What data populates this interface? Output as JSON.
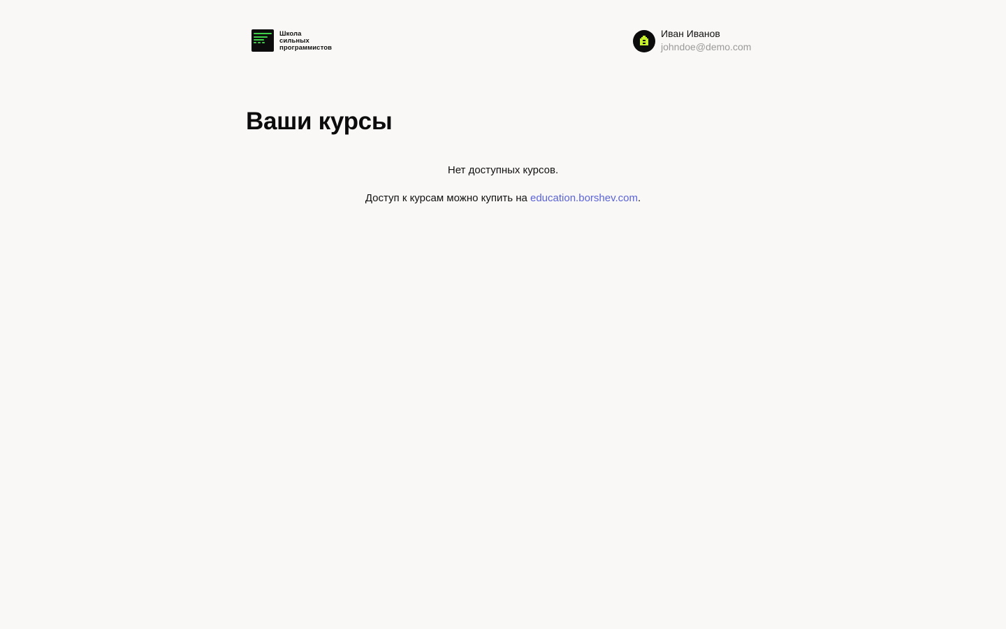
{
  "brand": {
    "name_lines": [
      "Школа",
      "сильных",
      "программистов"
    ],
    "accent_color": "#3fd14a"
  },
  "user": {
    "name": "Иван Иванов",
    "email": "johndoe@demo.com",
    "avatar_icon": "pixel-house-icon",
    "avatar_color": "#c6f02e"
  },
  "main": {
    "title": "Ваши курсы",
    "empty_message": "Нет доступных курсов.",
    "purchase_prefix": "Доступ к курсам можно купить на ",
    "purchase_link_text": "education.borshev.com",
    "purchase_suffix": ".",
    "link_color": "#5a63d9"
  }
}
